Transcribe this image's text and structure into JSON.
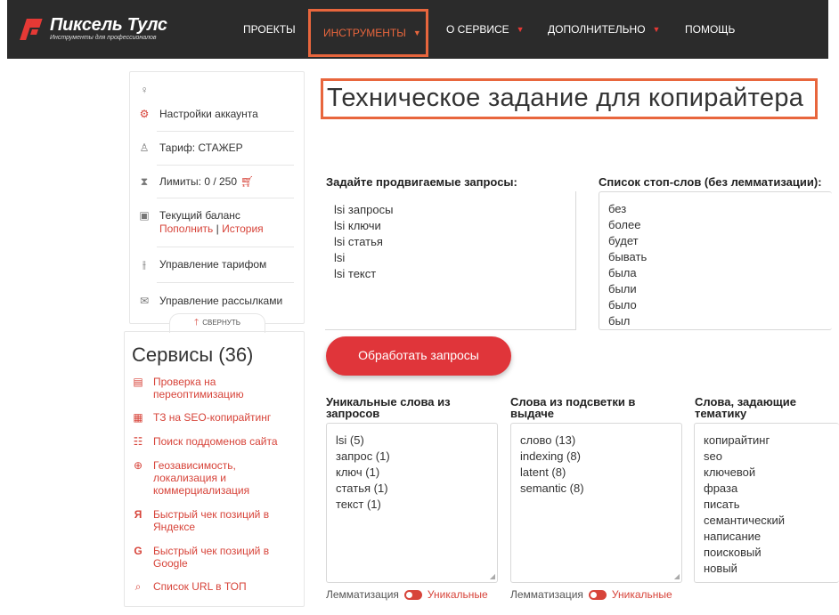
{
  "brand": {
    "name": "Пиксель Тулс",
    "tagline": "Инструменты для профессионалов"
  },
  "nav": [
    {
      "label": "ПРОЕКТЫ",
      "has_arrow": false,
      "active": false
    },
    {
      "label": "ИНСТРУМЕНТЫ",
      "has_arrow": true,
      "active": true
    },
    {
      "label": "О СЕРВИСЕ",
      "has_arrow": true,
      "active": false
    },
    {
      "label": "ДОПОЛНИТЕЛЬНО",
      "has_arrow": true,
      "active": false
    },
    {
      "label": "ПОМОЩЬ",
      "has_arrow": false,
      "active": false
    }
  ],
  "account": {
    "settings": "Настройки аккаунта",
    "tariff": "Тариф: СТАЖЕР",
    "limits": "Лимиты: 0 / 250",
    "balance": "Текущий баланс",
    "top_up": "Пополнить",
    "divider": "|",
    "history": "История",
    "manage_tariff": "Управление тарифом",
    "manage_mailing": "Управление рассылками",
    "collapse": "СВЕРНУТЬ"
  },
  "services": {
    "title": "Сервисы (36)",
    "items": [
      {
        "icon": "report-icon",
        "label": "Проверка на переоптимизацию"
      },
      {
        "icon": "document-icon",
        "label": "ТЗ на SEO-копирайтинг"
      },
      {
        "icon": "network-icon",
        "label": "Поиск поддоменов сайта"
      },
      {
        "icon": "globe-icon",
        "label": "Геозависимость, локализация и коммерциализация"
      },
      {
        "icon": "yandex-icon",
        "label": "Быстрый чек позиций в Яндексе"
      },
      {
        "icon": "google-icon",
        "label": "Быстрый чек позиций в Google"
      },
      {
        "icon": "search-icon",
        "label": "Список URL в ТОП"
      }
    ]
  },
  "page_title": "Техническое задание для копирайтера",
  "queries": {
    "label": "Задайте продвигаемые запросы:",
    "lines": [
      "lsi запросы",
      "lsi  ключи",
      "lsi  статья",
      "lsi",
      "lsi  текст"
    ]
  },
  "stopwords": {
    "label": "Список стоп-слов (без лемматизации):",
    "lines": [
      "без",
      "более",
      "будет",
      "бывать",
      "была",
      "были",
      "было",
      "был"
    ]
  },
  "process_button": "Обработать запросы",
  "unique_words": {
    "label": "Уникальные слова из запросов",
    "lines": [
      "lsi (5)",
      "запрос (1)",
      "ключ (1)",
      "статья (1)",
      "текст (1)"
    ]
  },
  "highlight_words": {
    "label": "Слова из подсветки в выдаче",
    "lines": [
      "слово (13)",
      "indexing (8)",
      "latent (8)",
      "semantic (8)"
    ]
  },
  "topic_words": {
    "label": "Слова, задающие тематику",
    "lines": [
      "копирайтинг",
      "seo",
      "ключевой",
      "фраза",
      "писать",
      "семантический",
      "написание",
      "поисковый",
      "новый"
    ]
  },
  "toggles": {
    "lemmatization": "Лемматизация",
    "unique": "Уникальные"
  },
  "colors": {
    "accent": "#e0353a",
    "highlight": "#e8663d",
    "topbar": "#2b2b2b"
  }
}
